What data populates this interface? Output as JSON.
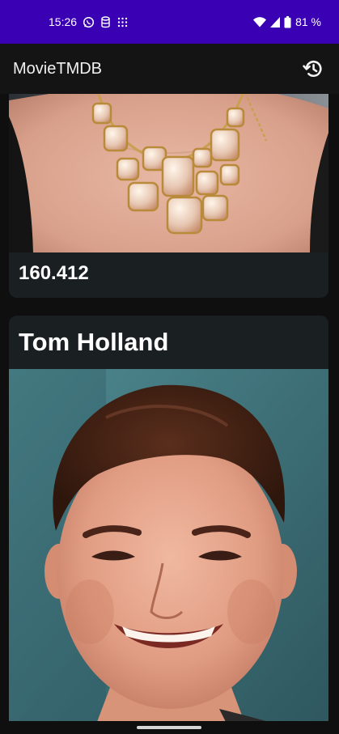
{
  "status_bar": {
    "time": "15:26",
    "battery": "81 %",
    "icons": [
      "whatsapp-icon",
      "database-icon",
      "grid-dots-icon",
      "wifi-icon",
      "signal-icon",
      "battery-icon"
    ],
    "background": "#3a00b4"
  },
  "app_bar": {
    "title": "MovieTMDB",
    "action_icon": "refresh-history-icon"
  },
  "cards": [
    {
      "image": "person-photo-necklace",
      "popularity": "160.412"
    },
    {
      "name": "Tom Holland",
      "image": "person-photo-tom-holland"
    }
  ],
  "colors": {
    "background": "#0f0f10",
    "card": "#1a1f22",
    "text": "#ffffff"
  }
}
